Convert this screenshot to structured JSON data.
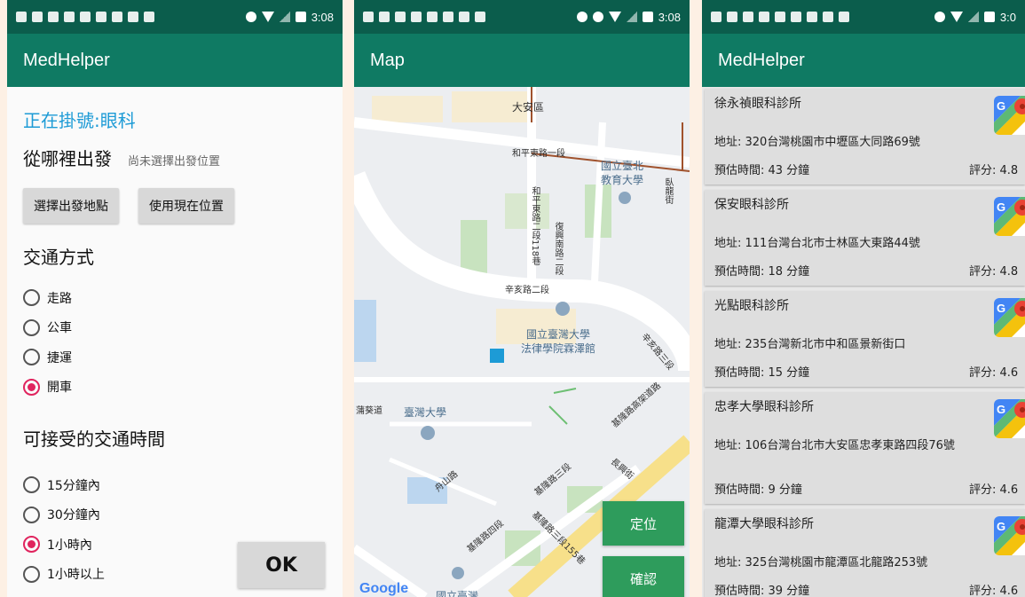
{
  "status_time": "3:08",
  "status_time_cropped": "3:0",
  "phone1": {
    "app_title": "MedHelper",
    "booking_title": "正在掛號:眼科",
    "from_label": "從哪裡出發",
    "from_status": "尚未選擇出發位置",
    "choose_start_button": "選擇出發地點",
    "use_current_button": "使用現在位置",
    "transport_heading": "交通方式",
    "transport_options": [
      "走路",
      "公車",
      "捷運",
      "開車"
    ],
    "transport_selected": "開車",
    "time_heading": "可接受的交通時間",
    "time_options": [
      "15分鐘內",
      "30分鐘內",
      "1小時內",
      "1小時以上"
    ],
    "time_selected": "1小時內",
    "ok_button": "OK"
  },
  "phone2": {
    "app_title": "Map",
    "labels": {
      "daan": "大安區",
      "heping_road": "和平東路一段",
      "ntue": "國立臺北",
      "ntue2": "教育大學",
      "lane118": "和平東路二段118巷",
      "fuxing": "復興南路二段",
      "wolong": "臥龍街",
      "xinhai": "辛亥路二段",
      "law_college": "國立臺灣大學",
      "law_college2": "法律學院霖澤館",
      "xinhai3": "辛亥路三段",
      "keelung_elevated": "基隆路高架道路",
      "shuiyuan": "蒲葵道",
      "ntu": "臺灣大學",
      "zhoushan": "舟山路",
      "keelung3": "基隆路三段",
      "changxing": "長興街",
      "keelung4": "基隆路四段",
      "keelung_lane": "基隆路三段155巷",
      "ntu_bottom": "國立臺灣"
    },
    "locate_button": "定位",
    "confirm_button": "確認",
    "google": "Google"
  },
  "phone3": {
    "app_title": "MedHelper",
    "clinics": [
      {
        "name": "徐永禎眼科診所",
        "address": "地址: 320台灣桃園市中壢區大同路69號",
        "time": "預估時間: 43 分鐘",
        "rating": "評分: 4.8"
      },
      {
        "name": "保安眼科診所",
        "address": "地址: 111台灣台北市士林區大東路44號",
        "time": "預估時間: 18 分鐘",
        "rating": "評分: 4.8"
      },
      {
        "name": "光點眼科診所",
        "address": "地址: 235台灣新北市中和區景新街口",
        "time": "預估時間: 15 分鐘",
        "rating": "評分: 4.6"
      },
      {
        "name": "忠孝大學眼科診所",
        "address": "地址: 106台灣台北市大安區忠孝東路四段76號",
        "time": "預估時間: 9 分鐘",
        "rating": "評分: 4.6"
      },
      {
        "name": "龍潭大學眼科診所",
        "address": "地址: 325台灣桃園市龍潭區北龍路253號",
        "time": "預估時間: 39 分鐘",
        "rating": "評分: 4.6"
      }
    ]
  },
  "colors": {
    "status_bar": "#0b5d4c",
    "app_bar": "#0f7a63",
    "accent_pink": "#e0245e",
    "title_blue": "#1d9bd6",
    "map_button": "#2e9c5c"
  }
}
